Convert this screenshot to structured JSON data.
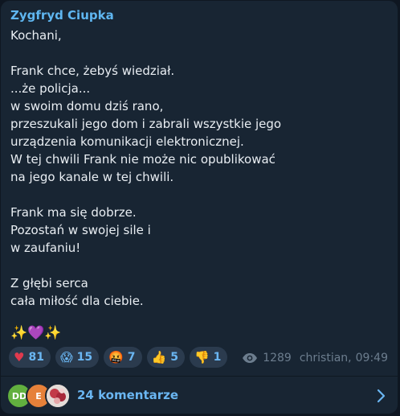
{
  "post": {
    "sender": "Zygfryd Ciupka",
    "lines": [
      "Kochani,",
      "",
      "Frank chce, żebyś wiedział.",
      "...że policja...",
      "w swoim domu dziś rano,",
      "przeszukali jego dom i zabrali wszystkie jego",
      "urządzenia komunikacji elektronicznej.",
      "W tej chwili Frank nie może nic opublikować",
      "na jego kanale w tej chwili.",
      "",
      "Frank ma się dobrze.",
      "Pozostań w swojej sile i",
      "w zaufaniu!",
      "",
      "Z głębi serca",
      "cała miłość dla ciebie.",
      ""
    ],
    "emoji_line": "✨💜✨"
  },
  "reactions": [
    {
      "emoji": "♥",
      "count": "81",
      "icon": "heart-icon"
    },
    {
      "emoji": "😱",
      "count": "15",
      "icon": "scream-face-icon"
    },
    {
      "emoji": "🤬",
      "count": "7",
      "icon": "cursing-face-icon"
    },
    {
      "emoji": "👍",
      "count": "5",
      "icon": "thumbs-up-icon"
    },
    {
      "emoji": "👎",
      "count": "1",
      "icon": "thumbs-down-icon"
    }
  ],
  "meta": {
    "views": "1289",
    "author": "christian,",
    "time": "09:49"
  },
  "comments": {
    "avatars": [
      {
        "initials": "DD",
        "color": "#62b03f"
      },
      {
        "initials": "E",
        "color": "#e6813a"
      },
      {
        "initials": "",
        "color": "#d6d0cc"
      }
    ],
    "label": "24 komentarze"
  },
  "colors": {
    "background": "#0e1621",
    "bubble": "#182533",
    "accent": "#6ab6f2",
    "sender": "#5fb6f0",
    "text": "#e9eef3",
    "meta": "#6c7d8e"
  }
}
